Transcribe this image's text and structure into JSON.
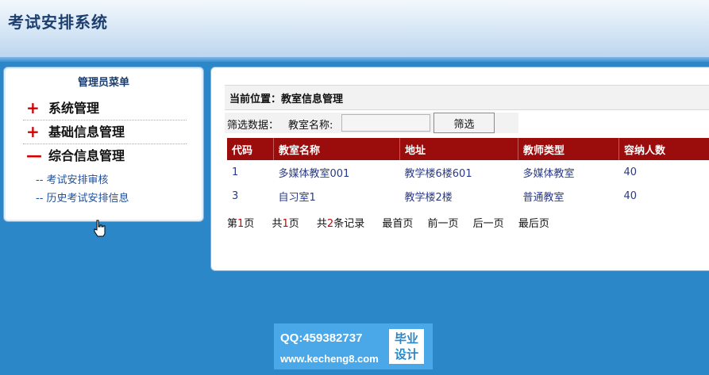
{
  "app": {
    "title": "考试安排系统"
  },
  "sidebar": {
    "title": "管理员菜单",
    "items": [
      {
        "sign": "+",
        "label": "系统管理"
      },
      {
        "sign": "+",
        "label": "基础信息管理"
      },
      {
        "sign": "—",
        "label": "综合信息管理"
      }
    ],
    "subitems": [
      {
        "label": "-- 考试安排审核"
      },
      {
        "label": "-- 历史考试安排信息"
      }
    ]
  },
  "main": {
    "breadcrumb": "当前位置：教室信息管理",
    "filter": {
      "label": "筛选数据：",
      "field_label": "教室名称:",
      "value": "",
      "button": "筛选"
    },
    "table": {
      "headers": [
        "代码",
        "教室名称",
        "地址",
        "教师类型",
        "容纳人数"
      ],
      "rows": [
        [
          "1",
          "多媒体教室001",
          "教学楼6楼601",
          "多媒体教室",
          "40"
        ],
        [
          "3",
          "自习室1",
          "教学楼2楼",
          "普通教室",
          "40"
        ]
      ]
    },
    "pager": {
      "page_prefix": "第",
      "page_num": "1",
      "page_suffix": "页",
      "total_prefix": "共",
      "total_pages": "1",
      "total_suffix": "页",
      "records_prefix": "共",
      "records": "2",
      "records_suffix": "条记录",
      "first": "最首页",
      "prev": "前一页",
      "next": "后一页",
      "last": "最后页"
    }
  },
  "watermark": {
    "qq": "QQ:459382737",
    "url": "www.kecheng8.com",
    "logo_line1": "毕业",
    "logo_line2": "设计"
  },
  "colors": {
    "background": "#2c87c8",
    "table_header": "#9b0d0d",
    "accent_red": "#d40000",
    "link_blue": "#1f4f9a"
  }
}
